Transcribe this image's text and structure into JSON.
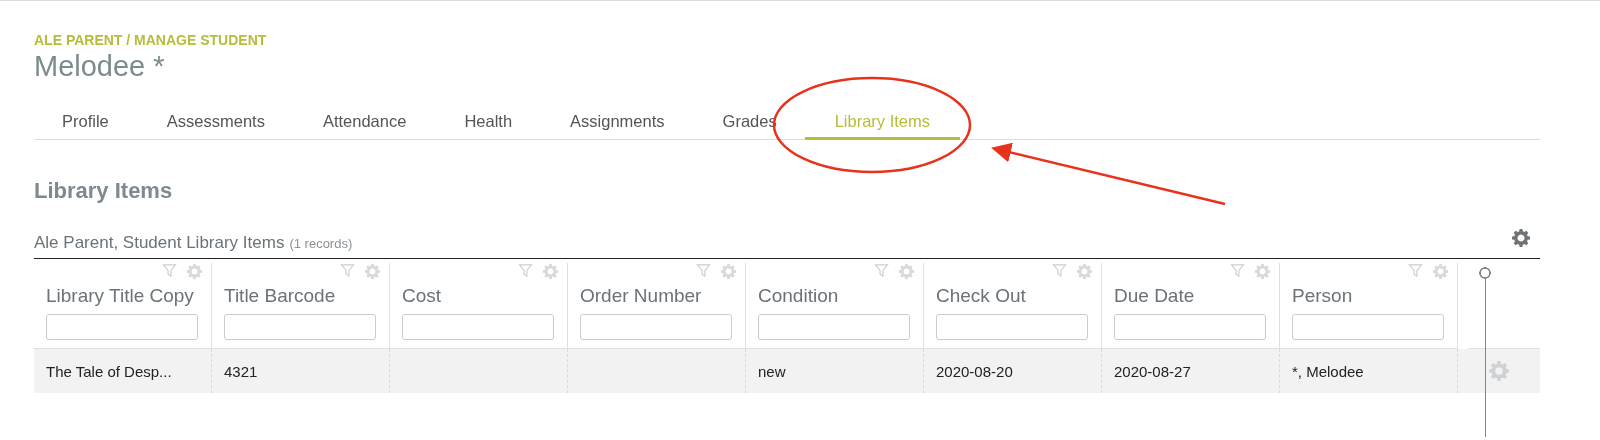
{
  "breadcrumb": "ALE PARENT / MANAGE STUDENT",
  "title": "Melodee *",
  "tabs": [
    {
      "label": "Profile",
      "selected": false
    },
    {
      "label": "Assessments",
      "selected": false
    },
    {
      "label": "Attendance",
      "selected": false
    },
    {
      "label": "Health",
      "selected": false
    },
    {
      "label": "Assignments",
      "selected": false
    },
    {
      "label": "Grades",
      "selected": false
    },
    {
      "label": "Library Items",
      "selected": true
    }
  ],
  "section_title": "Library Items",
  "grid": {
    "caption": "Ale Parent, Student Library Items",
    "record_count": "(1 records)",
    "columns": [
      "Library Title Copy",
      "Title Barcode",
      "Cost",
      "Order Number",
      "Condition",
      "Check Out",
      "Due Date",
      "Person"
    ],
    "rows": [
      [
        "The Tale of Desp...",
        "4321",
        "",
        "",
        "new",
        "2020-08-20",
        "2020-08-27",
        "*, Melodee"
      ]
    ]
  }
}
